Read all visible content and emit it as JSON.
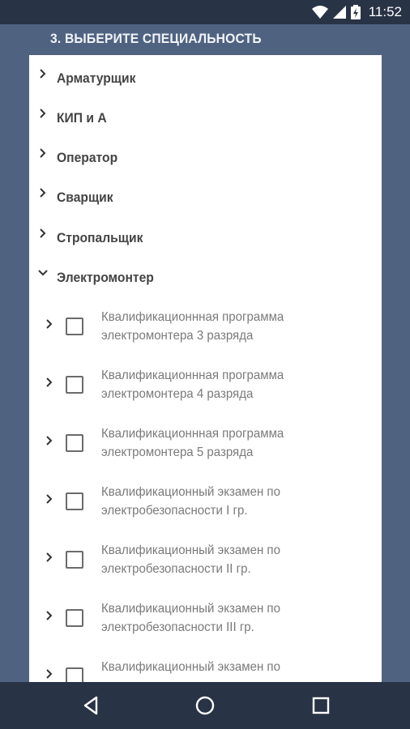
{
  "status_bar": {
    "time": "11:52",
    "icons": [
      "wifi-icon",
      "signal-icon",
      "battery-icon"
    ]
  },
  "header": {
    "title": "3. ВЫБЕРИТЕ СПЕЦИАЛЬНОСТЬ"
  },
  "categories": [
    {
      "label": "Арматурщик",
      "expanded": false
    },
    {
      "label": "КИП и А",
      "expanded": false
    },
    {
      "label": "Оператор",
      "expanded": false
    },
    {
      "label": "Сварщик",
      "expanded": false
    },
    {
      "label": "Стропальщик",
      "expanded": false
    },
    {
      "label": "Электромонтер",
      "expanded": true
    }
  ],
  "subitems": [
    {
      "line1": "Квалификационнная программа",
      "line2": "электромонтера 3 разряда",
      "checked": false
    },
    {
      "line1": "Квалификационнная программа",
      "line2": "электромонтера 4 разряда",
      "checked": false
    },
    {
      "line1": "Квалификационнная программа",
      "line2": "электромонтера 5 разряда",
      "checked": false
    },
    {
      "line1": "Квалификационный экзамен по",
      "line2": "электробезопасности I гр.",
      "checked": false
    },
    {
      "line1": "Квалификационный экзамен по",
      "line2": "электробезопасности II гр.",
      "checked": false
    },
    {
      "line1": "Квалификационный экзамен по",
      "line2": "электробезопасности III гр.",
      "checked": false
    },
    {
      "line1": "Квалификационный экзамен по",
      "line2": "",
      "checked": false
    }
  ],
  "colors": {
    "background": "#4f6381",
    "bars": "#293346",
    "panel": "#ffffff"
  }
}
